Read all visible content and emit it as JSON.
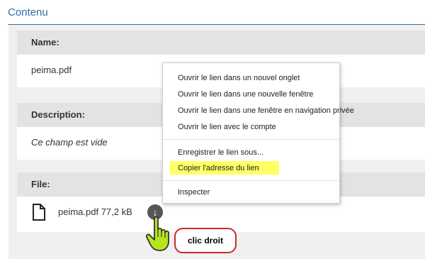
{
  "content_title": "Contenu",
  "fields": {
    "name": {
      "label": "Name:",
      "value": "peima.pdf"
    },
    "description": {
      "label": "Description:",
      "value": "Ce champ est vide"
    },
    "file": {
      "label": "File:",
      "file_text": "peima.pdf 77,2 kB",
      "download_icon": "arrow-down-icon",
      "file_icon": "document-icon"
    }
  },
  "context_menu": {
    "items": [
      "Ouvrir le lien dans un nouvel onglet",
      "Ouvrir le lien dans une nouvelle fenêtre",
      "Ouvrir le lien dans une fenêtre en navigation privée",
      "Ouvrir le lien avec le compte",
      "Enregistrer le lien sous...",
      "Copier l'adresse du lien",
      "Inspecter"
    ],
    "highlighted_item": "Copier l'adresse du lien",
    "highlight_color": "#ffff66"
  },
  "annotation": {
    "label": "clic droit",
    "border_color": "#cc2a2a",
    "cursor_icon": "hand-pointer-icon",
    "cursor_color": "#b5e61d"
  },
  "colors": {
    "title": "#2f6ea5",
    "panel_header": "#e3e3e3",
    "background_area": "#f0f0f0"
  }
}
